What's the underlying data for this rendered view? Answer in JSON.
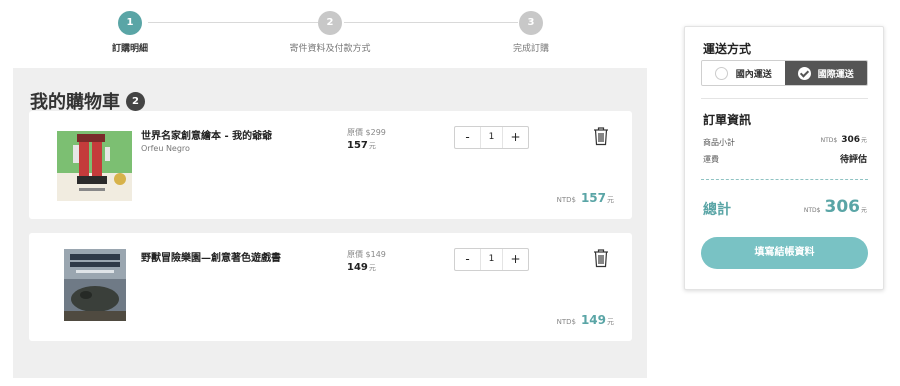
{
  "stepper": {
    "steps": [
      {
        "number": "1",
        "label": "訂購明細",
        "active": true
      },
      {
        "number": "2",
        "label": "寄件資料及付款方式",
        "active": false
      },
      {
        "number": "3",
        "label": "完成訂購",
        "active": false
      }
    ]
  },
  "cart": {
    "title": "我的購物車",
    "count": "2",
    "items": [
      {
        "name": "世界名家創意繪本 - 我的爺爺",
        "author": "Orfeu Negro",
        "original_price": "原價 $299",
        "price": "157",
        "price_unit": "元",
        "quantity": "1",
        "minus": "-",
        "plus": "+",
        "subtotal_currency": "NTD$",
        "subtotal": "157",
        "subtotal_unit": "元"
      },
      {
        "name": "野獸冒險樂園—創意著色遊戲書",
        "author": "",
        "original_price": "原價 $149",
        "price": "149",
        "price_unit": "元",
        "quantity": "1",
        "minus": "-",
        "plus": "+",
        "subtotal_currency": "NTD$",
        "subtotal": "149",
        "subtotal_unit": "元"
      }
    ]
  },
  "summary": {
    "shipping_heading": "運送方式",
    "shipping_options": {
      "domestic": "國內運送",
      "international": "國際運送",
      "selected": "international"
    },
    "order_heading": "訂單資訊",
    "subtotal_label": "商品小計",
    "subtotal_currency": "NTD$",
    "subtotal_value": "306",
    "subtotal_unit": "元",
    "shipping_fee_label": "運費",
    "shipping_fee_value": "待評估",
    "total_label": "總計",
    "total_currency": "NTD$",
    "total_value": "306",
    "total_unit": "元",
    "checkout_label": "填寫結帳資料"
  },
  "colors": {
    "accent": "#5aa5a6",
    "button": "#79c2c4",
    "selected_toggle": "#555555"
  },
  "icons": {
    "delete": "trash-icon",
    "selected": "check-circle-icon"
  }
}
